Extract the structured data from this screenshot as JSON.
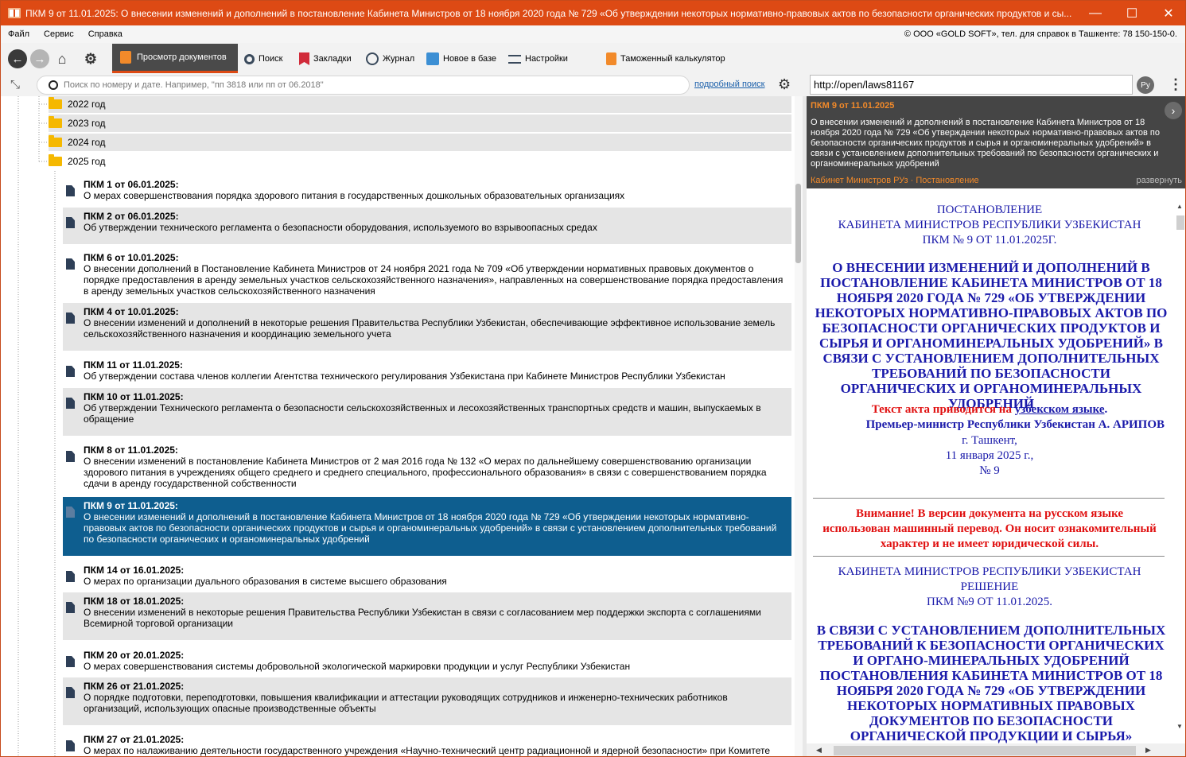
{
  "window": {
    "title": "ПКМ 9 от 11.01.2025: О внесении изменений и дополнений в постановление Кабинета Министров от 18 ноября 2020 года № 729 «Об утверждении некоторых нормативно-правовых актов по  безопасности органических продуктов и сы...",
    "minimize": "—",
    "maximize": "☐",
    "close": "✕"
  },
  "menu": {
    "items": [
      "Файл",
      "Сервис",
      "Справка"
    ],
    "copyright": "© ООО «GOLD SOFT», тел. для справок в Ташкенте: 78 150-150-0."
  },
  "toolbar": {
    "active_tab": "Просмотр документов",
    "search": "Поиск",
    "bookmarks": "Закладки",
    "journal": "Журнал",
    "new": "Новое в базе",
    "settings": "Настройки",
    "calculator": "Таможенный калькулятор"
  },
  "search": {
    "placeholder": "Поиск по номеру и дате. Например, \"пп 3818 или пп от 06.2018\"",
    "advanced_link": "подробный поиск",
    "url": "http://open/laws81167",
    "lang": "Ру"
  },
  "tree": {
    "years": [
      "2022 год",
      "2023 год",
      "2024 год",
      "2025 год"
    ],
    "docs": [
      {
        "title": "ПКМ 1 от 06.01.2025:",
        "desc": "О мерах совершенствования порядка  здорового питания в государственных  дошкольных образовательных организациях"
      },
      {
        "title": "ПКМ 2 от 06.01.2025:",
        "desc": "Об утверждении технического регламента о безопасности оборудования, используемого во взрывоопасных средах"
      },
      {
        "title": "ПКМ 6 от 10.01.2025:",
        "desc": "О внесении дополнений в Постановление Кабинета Министров от 24 ноября 2021 года № 709 «Об утверждении нормативных правовых документов о порядке предоставления в аренду земельных участков сельскохозяйственного назначения», направленных на совершенствование порядка предоставления в аренду земельных участков сельскохозяйственного назначения"
      },
      {
        "title": "ПКМ 4 от 10.01.2025:",
        "desc": "О внесении изменений и дополнений в некоторые решения Правительства Республики Узбекистан, обеспечивающие эффективное использование земель сельскохозяйственного назначения и координацию земельного учета"
      },
      {
        "title": "ПКМ 11 от 11.01.2025:",
        "desc": "Об утверждении состава членов коллегии Агентства технического регулирования Узбекистана при Кабинете Министров Республики Узбекистан"
      },
      {
        "title": "ПКМ 10 от 11.01.2025:",
        "desc": "Об утверждении Технического регламента о безопасности сельскохозяйственных и лесохозяйственных транспортных средств и машин, выпускаемых в обращение"
      },
      {
        "title": "ПКМ 8 от 11.01.2025:",
        "desc": "О внесении изменений в постановление Кабинета Министров от 2 мая 2016 года № 132 «О мерах по дальнейшему совершенствованию организации здорового питания в учреждениях общего среднего и среднего специального, профессионального образования» в связи с совершенствованием порядка сдачи в аренду государственной собственности"
      },
      {
        "title": "ПКМ 9 от 11.01.2025:",
        "desc": "О внесении изменений и дополнений в постановление Кабинета Министров от 18 ноября 2020 года № 729 «Об утверждении некоторых нормативно-правовых актов по  безопасности органических продуктов и сырья и органоминеральных удобрений» в связи с установлением дополнительных требований по безопасности органических и органоминеральных удобрений"
      },
      {
        "title": "ПКМ 14 от 16.01.2025:",
        "desc": "О мерах по организации дуального образования в системе высшего образования"
      },
      {
        "title": "ПКМ 18 от 18.01.2025:",
        "desc": "О внесении изменений в некоторые решения Правительства Республики Узбекистан в связи с согласованием мер поддержки экспорта с соглашениями Всемирной торговой организации"
      },
      {
        "title": "ПКМ 20 от 20.01.2025:",
        "desc": "О мерах совершенствования системы добровольной экологической маркировки продукции и услуг Республики Узбекистан"
      },
      {
        "title": "ПКМ 26 от 21.01.2025:",
        "desc": "О порядке подготовки, переподготовки, повышения квалификации и аттестации руководящих сотрудников и инженерно-технических работников организаций, использующих опасные производственные объекты"
      },
      {
        "title": "ПКМ 27 от 21.01.2025:",
        "desc": "О мерах по налаживанию деятельности государственного учреждения «Научно-технический центр радиационной и ядерной безопасности» при Комитете"
      }
    ]
  },
  "info": {
    "title": "ПКМ 9 от 11.01.2025",
    "body": "О внесении изменений и дополнений в постановление Кабинета Министров от 18 ноября 2020 года № 729 «Об утверждении некоторых нормативно-правовых актов по  безопасности органических продуктов и сырья и органоминеральных удобрений» в связи с установлением дополнительных требований по безопасности органических и органоминеральных удобрений",
    "source": "Кабинет Министров РУз  ·  Постановление",
    "expand": "развернуть"
  },
  "document": {
    "h1": "ПОСТАНОВЛЕНИЕ",
    "h2": "КАБИНЕТА МИНИСТРОВ РЕСПУБЛИКИ УЗБЕКИСТАН",
    "h3": "ПКМ № 9 ОТ 11.01.2025Г.",
    "title": "О ВНЕСЕНИИ ИЗМЕНЕНИЙ И ДОПОЛНЕНИЙ В ПОСТАНОВЛЕНИЕ КАБИНЕТА МИНИСТРОВ ОТ 18 НОЯБРЯ 2020 ГОДА № 729 «ОБ УТВЕРЖДЕНИИ НЕКОТОРЫХ НОРМАТИВНО-ПРАВОВЫХ АКТОВ ПО БЕЗОПАСНОСТИ ОРГАНИЧЕСКИХ ПРОДУКТОВ И СЫРЬЯ И ОРГАНОМИНЕРАЛЬНЫХ УДОБРЕНИЙ» В СВЯЗИ С УСТАНОВЛЕНИЕМ ДОПОЛНИТЕЛЬНЫХ ТРЕБОВАНИЙ ПО БЕЗОПАСНОСТИ ОРГАНИЧЕСКИХ И ОРГАНОМИНЕРАЛЬНЫХ УДОБРЕНИЙ",
    "uz_prefix": "Текст акта приводится на ",
    "uz_link": "узбекском языке",
    "uz_suffix": ".",
    "signer": "Премьер-министр Республики Узбекистан А. АРИПОВ",
    "city": "г. Ташкент,",
    "date": "11 января 2025 г.,",
    "num": "№ 9",
    "warning": "Внимание! В версии документа на русском языке использован машинный перевод. Он носит ознакомительный характер и не имеет юридической силы.",
    "h4": "КАБИНЕТА МИНИСТРОВ РЕСПУБЛИКИ УЗБЕКИСТАН",
    "h5": "РЕШЕНИЕ",
    "h6": "ПКМ №9 ОТ 11.01.2025.",
    "title2": "В СВЯЗИ С УСТАНОВЛЕНИЕМ ДОПОЛНИТЕЛЬНЫХ ТРЕБОВАНИЙ К БЕЗОПАСНОСТИ ОРГАНИЧЕСКИХ И ОРГАНО-МИНЕРАЛЬНЫХ УДОБРЕНИЙ ПОСТАНОВЛЕНИЯ КАБИНЕТА МИНИСТРОВ ОТ 18 НОЯБРЯ 2020 ГОДА № 729 «ОБ УТВЕРЖДЕНИИ НЕКОТОРЫХ НОРМАТИВНЫХ ПРАВОВЫХ ДОКУМЕНТОВ ПО БЕЗОПАСНОСТИ ОРГАНИЧЕСКОЙ ПРОДУКЦИИ И СЫРЬЯ» МАТЕРИАЛЫ И ОРГАНО-"
  },
  "colors": {
    "accent": "#dd4a14",
    "selection": "#0e5e8f",
    "doc_blue": "#1a1aaa",
    "warning_red": "#e01010"
  }
}
